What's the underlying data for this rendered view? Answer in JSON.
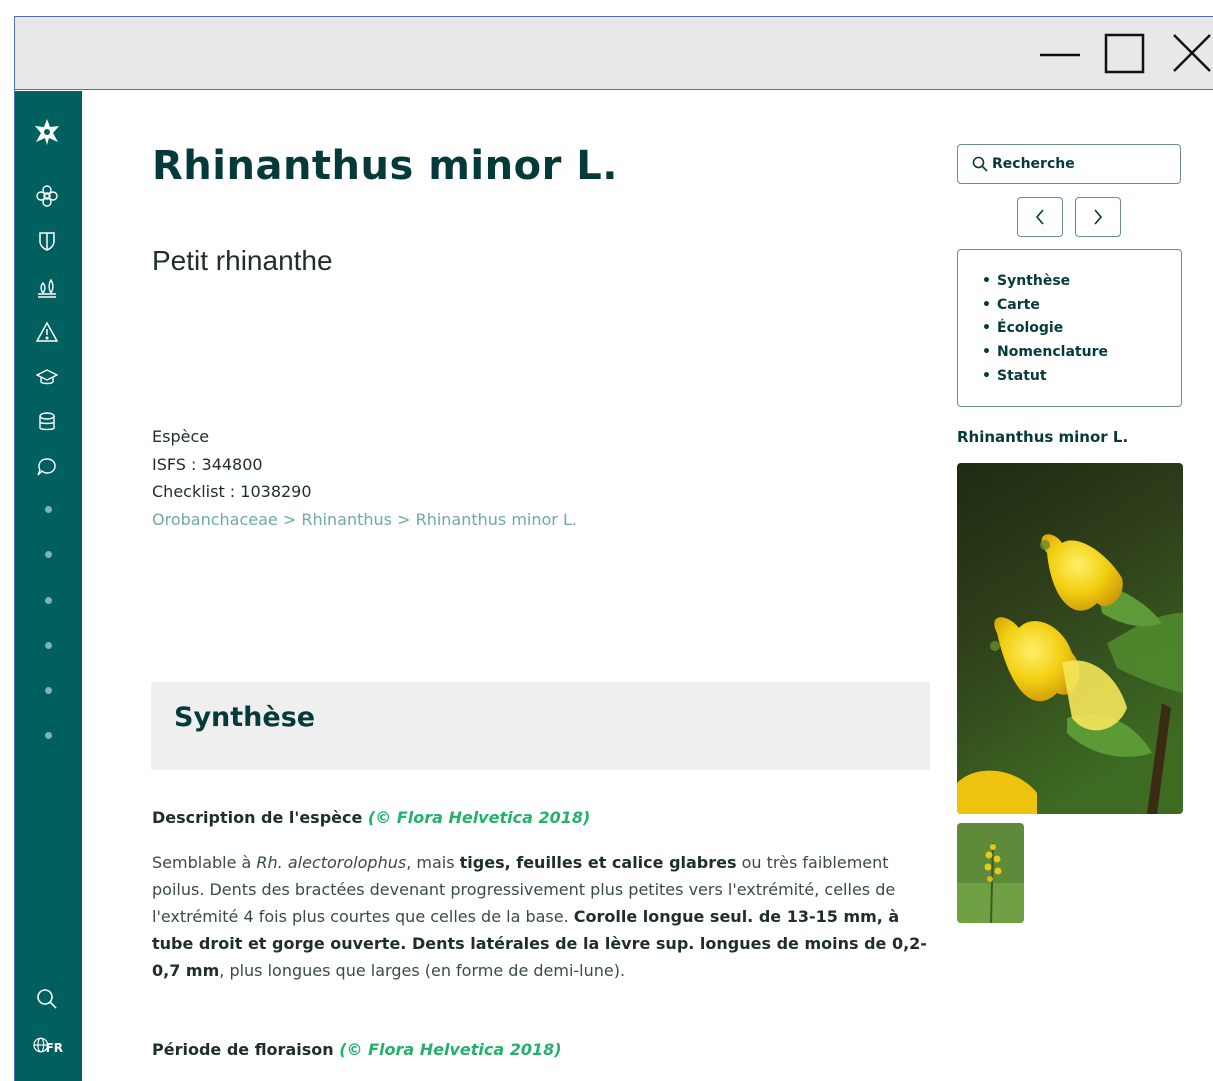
{
  "species": {
    "scientific_name": "Rhinanthus minor L.",
    "common_name": "Petit rhinanthe",
    "rank": "Espèce",
    "isfs": "ISFS : 344800",
    "checklist": "Checklist : 1038290",
    "breadcrumb": "Orobanchaceae > Rhinanthus > Rhinanthus minor L."
  },
  "section": {
    "title": "Synthèse",
    "description_label": "Description de l'espèce",
    "source": "(© Flora Helvetica 2018)",
    "flowering_label": "Période de floraison",
    "description": {
      "t1": "Semblable à ",
      "t2": "Rh. alectorolophus",
      "t3": ", mais ",
      "t4": "tiges, feuilles et calice glabres",
      "t5": " ou très faiblement poilus. Dents des bractées devenant progressivement plus petites vers l'extrémité, celles de l'extrémité 4 fois plus courtes que celles de la base. ",
      "t6": "Corolle longue seul. de 13-15 mm, à tube droit et gorge ouverte. Dents latérales de la lèvre sup. longues de moins de 0,2-0,7 mm",
      "t7": ", plus longues que larges (en forme de demi-lune)."
    }
  },
  "search": {
    "placeholder": "Recherche"
  },
  "toc": [
    "Synthèse",
    "Carte",
    "Écologie",
    "Nomenclature",
    "Statut"
  ],
  "image_caption": "Rhinanthus minor L.",
  "sidebar": {
    "icons": [
      "logo-flower-icon",
      "flower-icon",
      "shield-icon",
      "plants-icon",
      "warning-icon",
      "graduation-cap-icon",
      "database-icon",
      "chat-bubble-icon"
    ],
    "language": "FR"
  },
  "colors": {
    "sidebar": "#005f5f",
    "title": "#063a3a",
    "breadcrumb": "#6fa9a9",
    "source_green": "#21b36a",
    "section_bg": "#efefef"
  }
}
